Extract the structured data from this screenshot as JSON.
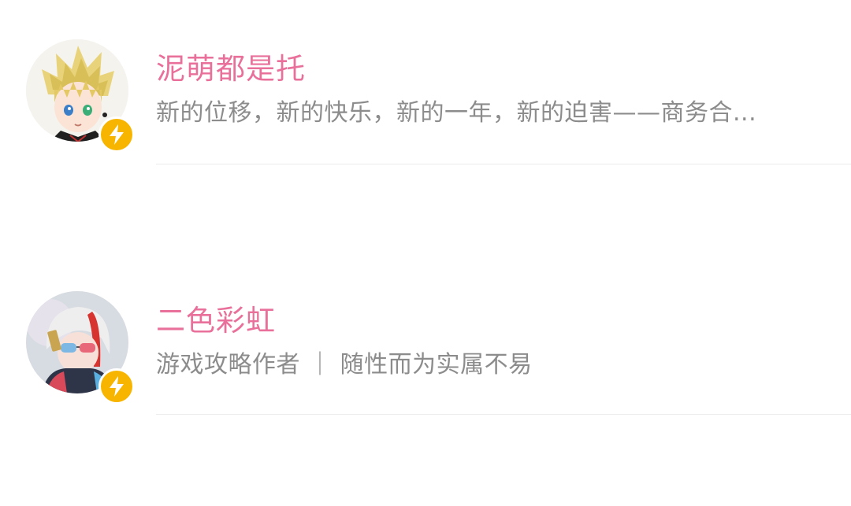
{
  "users": [
    {
      "name": "泥萌都是托",
      "description": "新的位移，新的快乐，新的一年，新的迫害——商务合...",
      "badge_icon": "lightning-icon",
      "colors": {
        "name": "#e8709a",
        "badge": "#f7b500"
      }
    },
    {
      "name": "二色彩虹",
      "description": "游戏攻略作者 ｜ 随性而为实属不易",
      "badge_icon": "lightning-icon",
      "colors": {
        "name": "#e8709a",
        "badge": "#f7b500"
      }
    }
  ]
}
